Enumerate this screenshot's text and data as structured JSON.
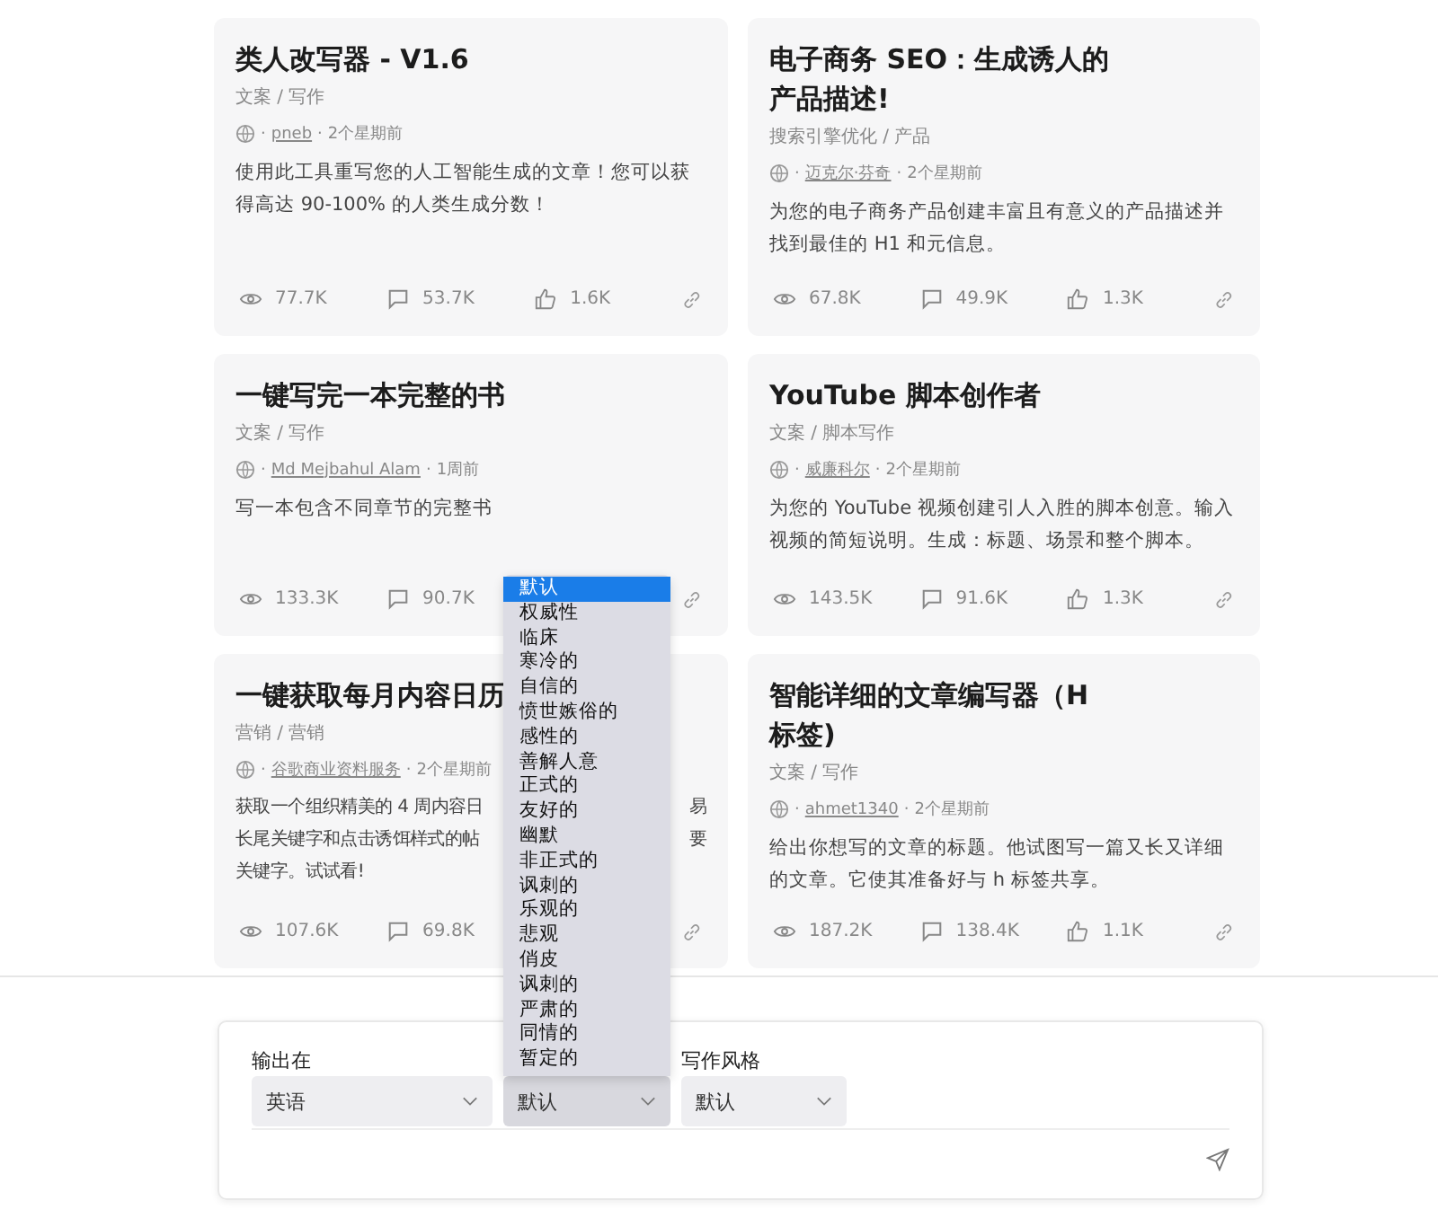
{
  "cards": [
    {
      "title": "类人改写器 - V1.6",
      "category": "文案 / 写作",
      "sep_before": "·",
      "author": "pneb",
      "sep_after": "·",
      "time": "2个星期前",
      "description": "使用此工具重写您的人工智能生成的文章！您可以获得高达 90-100% 的人类生成分数！",
      "views": "77.7K",
      "comments": "53.7K",
      "likes": "1.6K"
    },
    {
      "title": "电子商务 SEO：生成诱人的产品描述!",
      "category": "搜索引擎优化 / 产品",
      "sep_before": "·",
      "author": "迈克尔·芬奇",
      "sep_after": "·",
      "time": "2个星期前",
      "description": "为您的电子商务产品创建丰富且有意义的产品描述并找到最佳的 H1 和元信息。",
      "views": "67.8K",
      "comments": "49.9K",
      "likes": "1.3K"
    },
    {
      "title": "一键写完一本完整的书",
      "category": "文案 / 写作",
      "sep_before": "·",
      "author": "Md Mejbahul Alam",
      "sep_after": "·",
      "time": "1周前",
      "description": "写一本包含不同章节的完整书",
      "views": "133.3K",
      "comments": "90.7K"
    },
    {
      "title": "YouTube 脚本创作者",
      "category": "文案 / 脚本写作",
      "sep_before": "·",
      "author": "威廉科尔",
      "sep_after": "·",
      "time": "2个星期前",
      "description": "为您的 YouTube 视频创建引人入胜的脚本创意。输入视频的简短说明。生成：标题、场景和整个脚本。",
      "views": "143.5K",
      "comments": "91.6K",
      "likes": "1.3K"
    },
    {
      "title": "一键获取每月内容日历",
      "category": "营销 / 营销",
      "sep_before": "·",
      "author": "谷歌商业资料服务",
      "sep_after": "·",
      "time": "2个星期前",
      "description_parts": [
        {
          "start": "获取一个组织精美的 4 周内容日",
          "end": "易"
        },
        {
          "start": "长尾关键字和点击诱饵样式的帖",
          "end": "要"
        },
        {
          "start": "关键字。试试看!"
        }
      ],
      "views": "107.6K",
      "comments": "69.8K"
    },
    {
      "title": "智能详细的文章编写器（H 标签)",
      "category": "文案 / 写作",
      "sep_before": "·",
      "author": "ahmet1340",
      "sep_after": "·",
      "time": "2个星期前",
      "description": "给出你想写的文章的标题。他试图写一篇又长又详细的文章。它使其准备好与 h 标签共享。",
      "views": "187.2K",
      "comments": "138.4K",
      "likes": "1.1K"
    }
  ],
  "selects": [
    {
      "label": "输出在",
      "value": "英语",
      "open": false
    },
    {
      "value": "默认",
      "open": true,
      "options": [
        {
          "label": "默认",
          "selected": true
        },
        {
          "label": "权威性",
          "selected": false
        },
        {
          "label": "临床",
          "selected": false
        },
        {
          "label": "寒冷的",
          "selected": false
        },
        {
          "label": "自信的",
          "selected": false
        },
        {
          "label": "愤世嫉俗的",
          "selected": false
        },
        {
          "label": "感性的",
          "selected": false
        },
        {
          "label": "善解人意",
          "selected": false
        },
        {
          "label": "正式的",
          "selected": false
        },
        {
          "label": "友好的",
          "selected": false
        },
        {
          "label": "幽默",
          "selected": false
        },
        {
          "label": "非正式的",
          "selected": false
        },
        {
          "label": "讽刺的",
          "selected": false
        },
        {
          "label": "乐观的",
          "selected": false
        },
        {
          "label": "悲观",
          "selected": false
        },
        {
          "label": "俏皮",
          "selected": false
        },
        {
          "label": "讽刺的",
          "selected": false
        },
        {
          "label": "严肃的",
          "selected": false
        },
        {
          "label": "同情的",
          "selected": false
        },
        {
          "label": "暂定的",
          "selected": false
        }
      ]
    },
    {
      "label": "写作风格",
      "value": "默认",
      "open": false
    }
  ]
}
